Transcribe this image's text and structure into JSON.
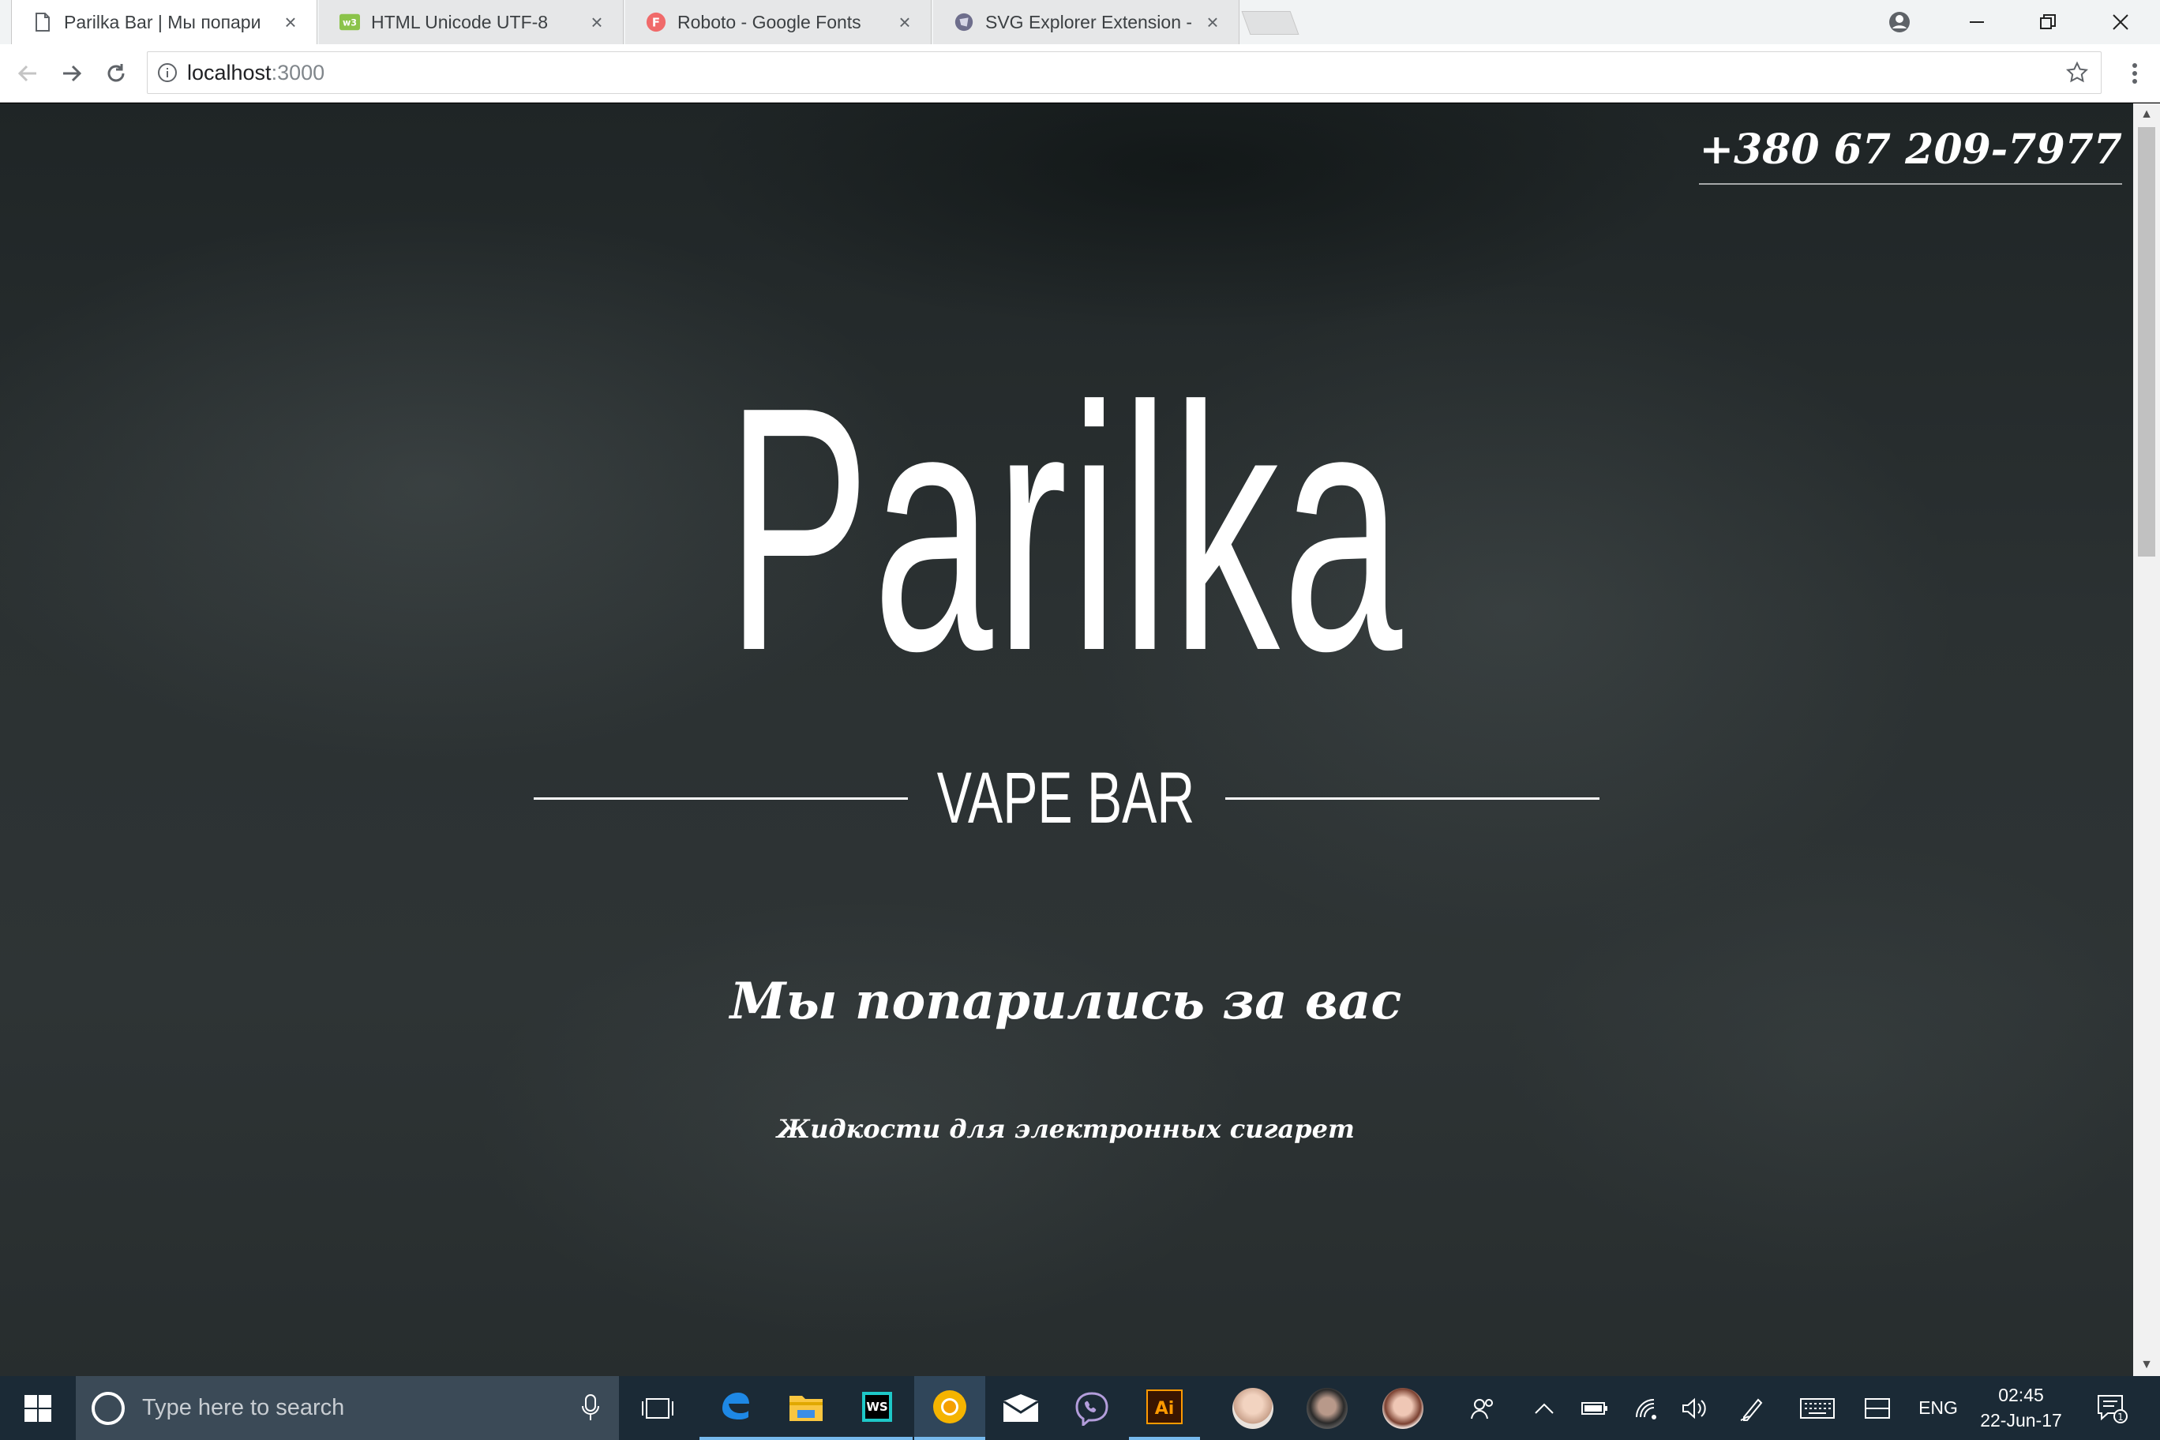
{
  "browser": {
    "tabs": [
      {
        "title": "Parilka Bar | Мы попари",
        "favicon": "page-icon",
        "active": true
      },
      {
        "title": "HTML Unicode UTF-8",
        "favicon": "w3schools-icon",
        "active": false
      },
      {
        "title": "Roboto - Google Fonts",
        "favicon": "google-fonts-icon",
        "active": false
      },
      {
        "title": "SVG Explorer Extension -",
        "favicon": "svg-explorer-icon",
        "active": false
      }
    ],
    "close_glyph": "×",
    "url_host": "localhost",
    "url_port": ":3000"
  },
  "page": {
    "phone": "+380 67 209-7977",
    "logo": "Parilka",
    "subtitle": "VAPE BAR",
    "tagline": "Мы попарились за вас",
    "description": "Жидкости для электронных сигарет"
  },
  "taskbar": {
    "search_placeholder": "Type here to search",
    "apps": [
      "task-view-icon",
      "edge-icon",
      "file-explorer-icon",
      "webstorm-icon",
      "chrome-icon",
      "mail-icon",
      "viber-icon",
      "illustrator-icon"
    ],
    "contacts": [
      "contact-1",
      "contact-2",
      "contact-3"
    ],
    "language": "ENG",
    "time": "02:45",
    "date": "22-Jun-17",
    "notification_count": "1"
  },
  "colors": {
    "page_bg": "#2b3132",
    "taskbar": "#1b2a36",
    "accent": "#76b9ed"
  }
}
